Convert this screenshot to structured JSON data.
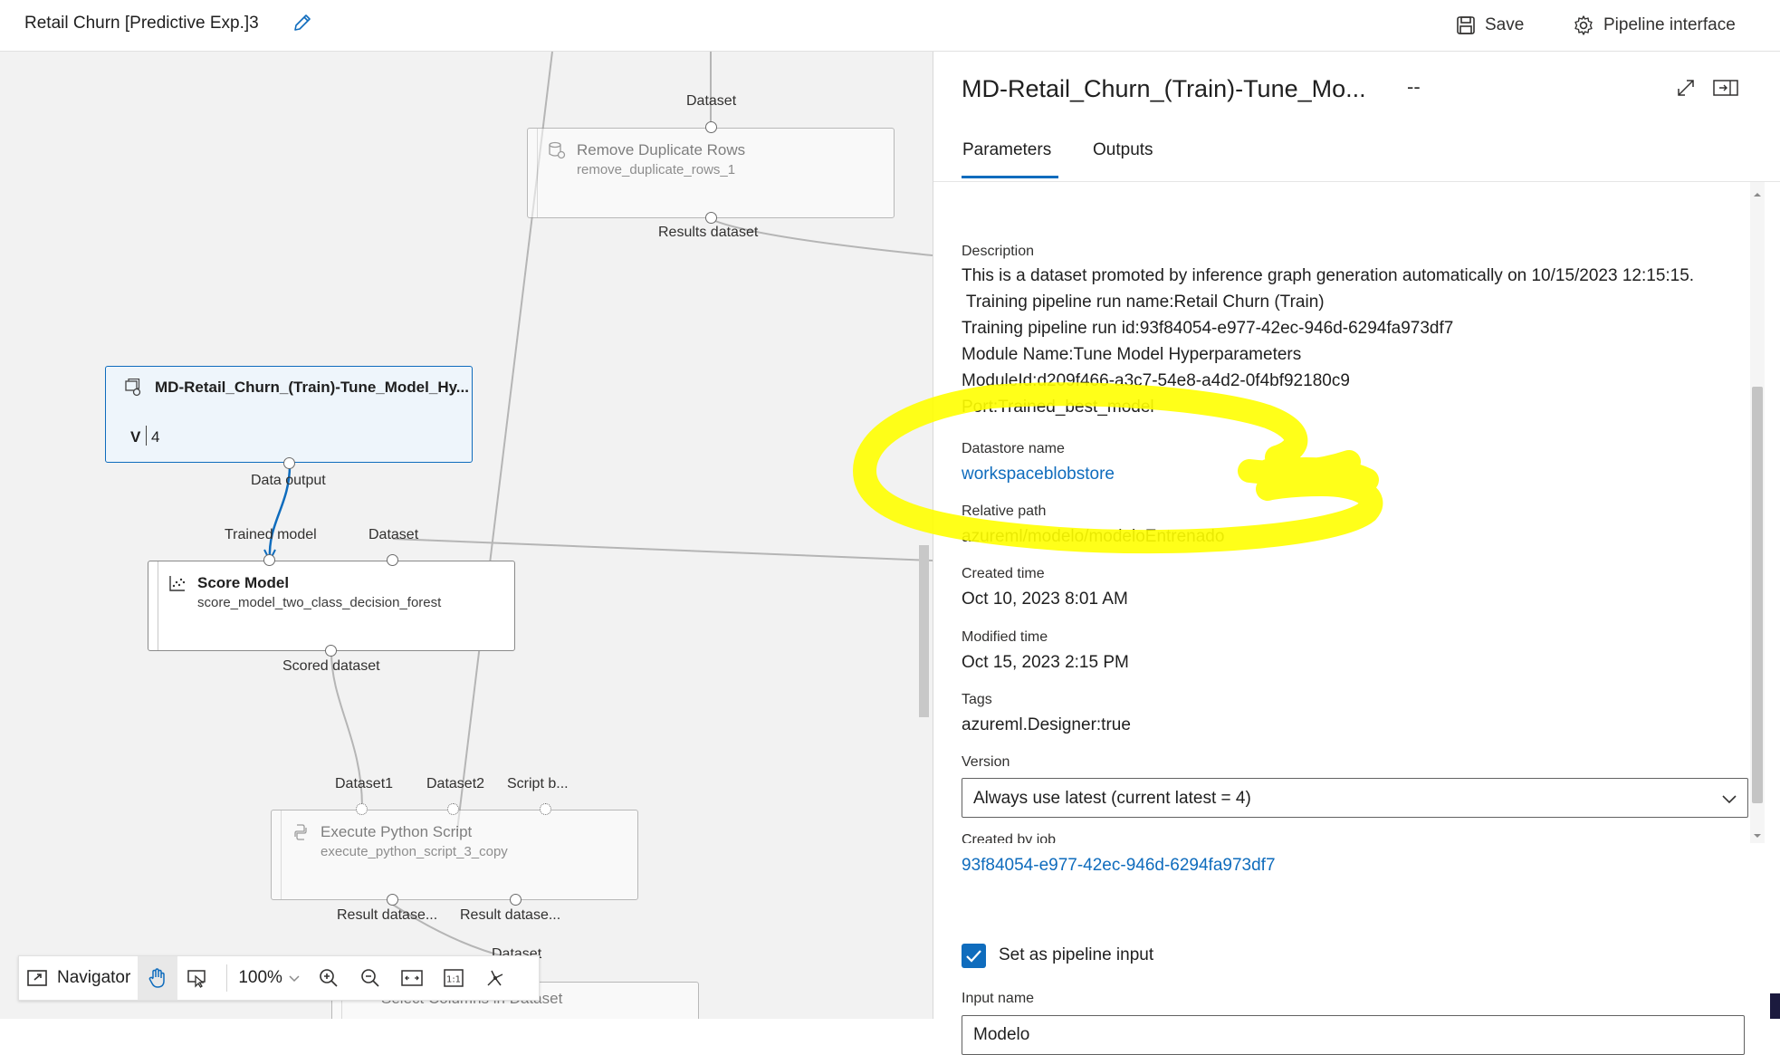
{
  "topbar": {
    "title": "Retail Churn [Predictive Exp.]3",
    "save_label": "Save",
    "pipeline_interface_label": "Pipeline interface"
  },
  "canvas": {
    "top_node": {
      "title": "Remove Duplicate Rows",
      "subtitle": "remove_duplicate_rows_1",
      "input_label": "Dataset",
      "output_label": "Results dataset"
    },
    "dataset_node": {
      "title": "MD-Retail_Churn_(Train)-Tune_Model_Hy...",
      "version_prefix": "V",
      "version_number": "4",
      "output_label": "Data output"
    },
    "score_node": {
      "title": "Score Model",
      "subtitle": "score_model_two_class_decision_forest",
      "input_label_1": "Trained model",
      "input_label_2": "Dataset",
      "output_label": "Scored dataset"
    },
    "python_node": {
      "title": "Execute Python Script",
      "subtitle": "execute_python_script_3_copy",
      "input_label_1": "Dataset1",
      "input_label_2": "Dataset2",
      "input_label_3": "Script b...",
      "output_label_1": "Result datase...",
      "output_label_2": "Result datase..."
    },
    "bottom_node": {
      "title": "Select Columns in Dataset",
      "input_label": "Dataset"
    }
  },
  "navigator": {
    "label": "Navigator",
    "zoom": "100%"
  },
  "panel": {
    "title": "MD-Retail_Churn_(Train)-Tune_Mo...",
    "title_suffix": "--",
    "tabs": [
      "Parameters",
      "Outputs"
    ],
    "active_tab": "Parameters",
    "description_label": "Description",
    "description_lines": [
      "This is a dataset promoted by inference graph generation automatically on 10/15/2023 12:15:15.",
      " Training pipeline run name:Retail Churn (Train)",
      "Training pipeline run id:93f84054-e977-42ec-946d-6294fa973df7",
      "Module Name:Tune Model Hyperparameters",
      "ModuleId:d209f466-a3c7-54e8-a4d2-0f4bf92180c9",
      "Port:Trained_best_model"
    ],
    "datastore_label": "Datastore name",
    "datastore_value": "workspaceblobstore",
    "relative_path_label": "Relative path",
    "relative_path_value": "azureml/modelo/modeloEntrenado",
    "created_time_label": "Created time",
    "created_time_value": "Oct 10, 2023 8:01 AM",
    "modified_time_label": "Modified time",
    "modified_time_value": "Oct 15, 2023 2:15 PM",
    "tags_label": "Tags",
    "tags_value": "azureml.Designer:true",
    "version_label": "Version",
    "version_value": "Always use latest (current latest = 4)",
    "created_by_job_label": "Created by job",
    "created_by_job_value": "93f84054-e977-42ec-946d-6294fa973df7",
    "pipeline_input_label": "Set as pipeline input",
    "pipeline_input_checked": true,
    "input_name_label": "Input name",
    "input_name_value": "Modelo"
  },
  "colors": {
    "accent": "#0f6cbd",
    "highlight": "#ffff00",
    "canvas_bg": "#f2f2f2",
    "selected_node_bg": "#eef5fb"
  },
  "icons": {
    "edit": "pencil-icon",
    "save": "floppy-icon",
    "pipeline_interface": "gear-icon",
    "expand": "expand-icon",
    "collapse_panel": "panel-collapse-icon",
    "version_dropdown": "chevron-down-icon"
  }
}
